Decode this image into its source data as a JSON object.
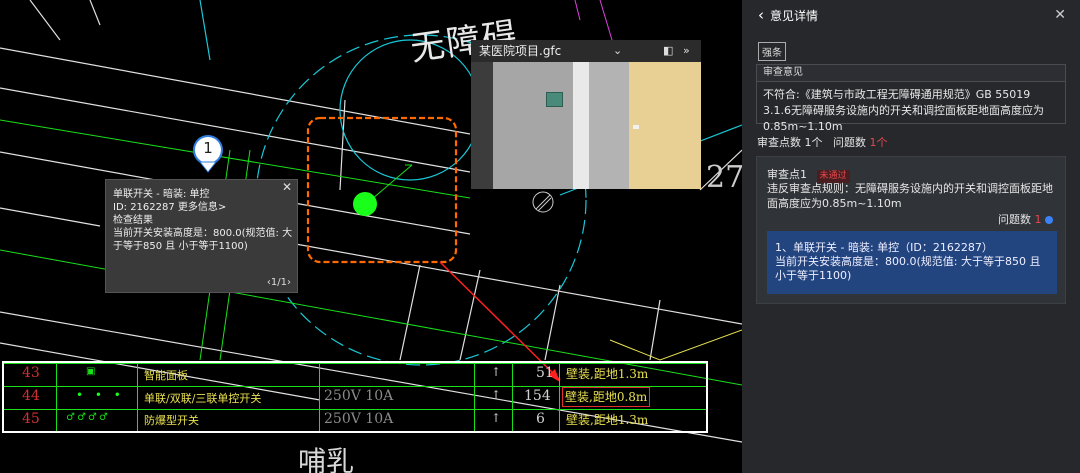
{
  "cad": {
    "top_text": "无障碍",
    "bottom_text": "哺乳",
    "marker_number": "1",
    "right_number": "27"
  },
  "tooltip": {
    "line1": "单联开关 - 暗装: 单控",
    "line2": "ID: 2162287 更多信息>",
    "line3": "检查结果",
    "line4": "当前开关安装高度是：800.0(规范值: 大于等于850 且 小于等于1100)",
    "pager": "1/1",
    "close": "✕"
  },
  "viewer": {
    "title": "某医院项目.gfc",
    "dropdown": "⌄",
    "panel_icon": "◧",
    "expand_icon": "»"
  },
  "table": {
    "rows": [
      {
        "no": "43",
        "name": "智能面板",
        "spec": "",
        "arrow": "↑",
        "h": "51",
        "install": "壁装,距地1.3m"
      },
      {
        "no": "44",
        "name": "单联/双联/三联单控开关",
        "spec": "250V 10A",
        "arrow": "↑",
        "h": "154",
        "install": "壁装,距地0.8m"
      },
      {
        "no": "45",
        "name": "防爆型开关",
        "spec": "250V 10A",
        "arrow": "↑",
        "h": "6",
        "install": "壁装,距地1.3m"
      }
    ]
  },
  "panel": {
    "title": "意见详情",
    "back": "‹",
    "close": "✕",
    "tag": "强条",
    "opinion_title": "审查意见",
    "opinion_text": "不符合:《建筑与市政工程无障碍通用规范》GB 55019 3.1.6无障碍服务设施内的开关和调控面板距地面高度应为0.85m~1.10m",
    "points_label": "审查点数 1个",
    "issues_label": "问题数",
    "issues_value": "1个",
    "card": {
      "title": "审查点1",
      "status": "未通过",
      "rule": "违反审查点规则：无障碍服务设施内的开关和调控面板距地面高度应为0.85m~1.10m",
      "qcount_label": "问题数",
      "qcount_value": "1",
      "issue_line1": "1、单联开关 - 暗装: 单控（ID：2162287）",
      "issue_line2": "当前开关安装高度是：800.0(规范值: 大于等于850 且 小于等于1100)"
    }
  },
  "colors": {
    "cad_green": "#19e019",
    "cad_cyan": "#19c8d8",
    "cad_yellow": "#e8e050",
    "cad_red": "#d03030",
    "cloud_orange": "#ff6a00",
    "fail_red": "#e5484d",
    "issue_blue": "#22447f"
  }
}
